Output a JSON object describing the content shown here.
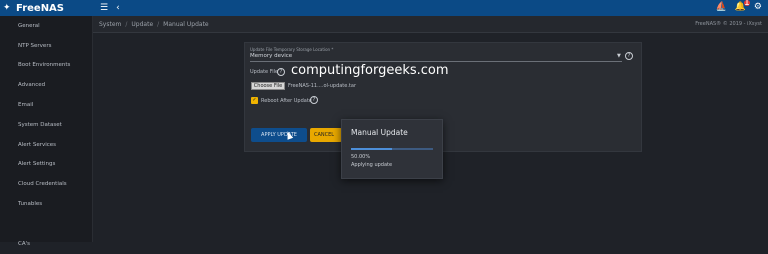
{
  "app": {
    "brand": "FreeNAS"
  },
  "topbar": {
    "menu_icon": "menu-icon",
    "back_icon": "chevron-left-icon",
    "notification_count": "1"
  },
  "sidebar": {
    "items": [
      {
        "label": "General"
      },
      {
        "label": "NTP Servers"
      },
      {
        "label": "Boot Environments"
      },
      {
        "label": "Advanced"
      },
      {
        "label": "Email"
      },
      {
        "label": "System Dataset"
      },
      {
        "label": "Alert Services"
      },
      {
        "label": "Alert Settings"
      },
      {
        "label": "Cloud Credentials"
      },
      {
        "label": "Tunables"
      },
      {
        "label": ""
      },
      {
        "label": "CA's"
      }
    ]
  },
  "breadcrumb": {
    "items": [
      "System",
      "Update",
      "Manual Update"
    ],
    "right_text": "FreeNAS® © 2019 - iXsyst"
  },
  "form": {
    "pool_label": "Update File Temporary Storage Location *",
    "pool_value": "Memory device",
    "update_file_label": "Update File",
    "choose_file_label": "Choose File",
    "file_name": "FreeNAS-11....ol-update.tar",
    "reboot_label": "Reboot After Update",
    "apply_label": "APPLY UPDATE",
    "cancel_label": "CANCEL"
  },
  "watermark": "computingforgeeks.com",
  "dialog": {
    "title": "Manual Update",
    "percent_text": "50.00%",
    "status_text": "Applying update",
    "progress": 0.5
  },
  "colors": {
    "topbar": "#0b4a86",
    "apply": "#0e4d8c",
    "cancel": "#e8a800",
    "checkbox": "#f0b400"
  }
}
